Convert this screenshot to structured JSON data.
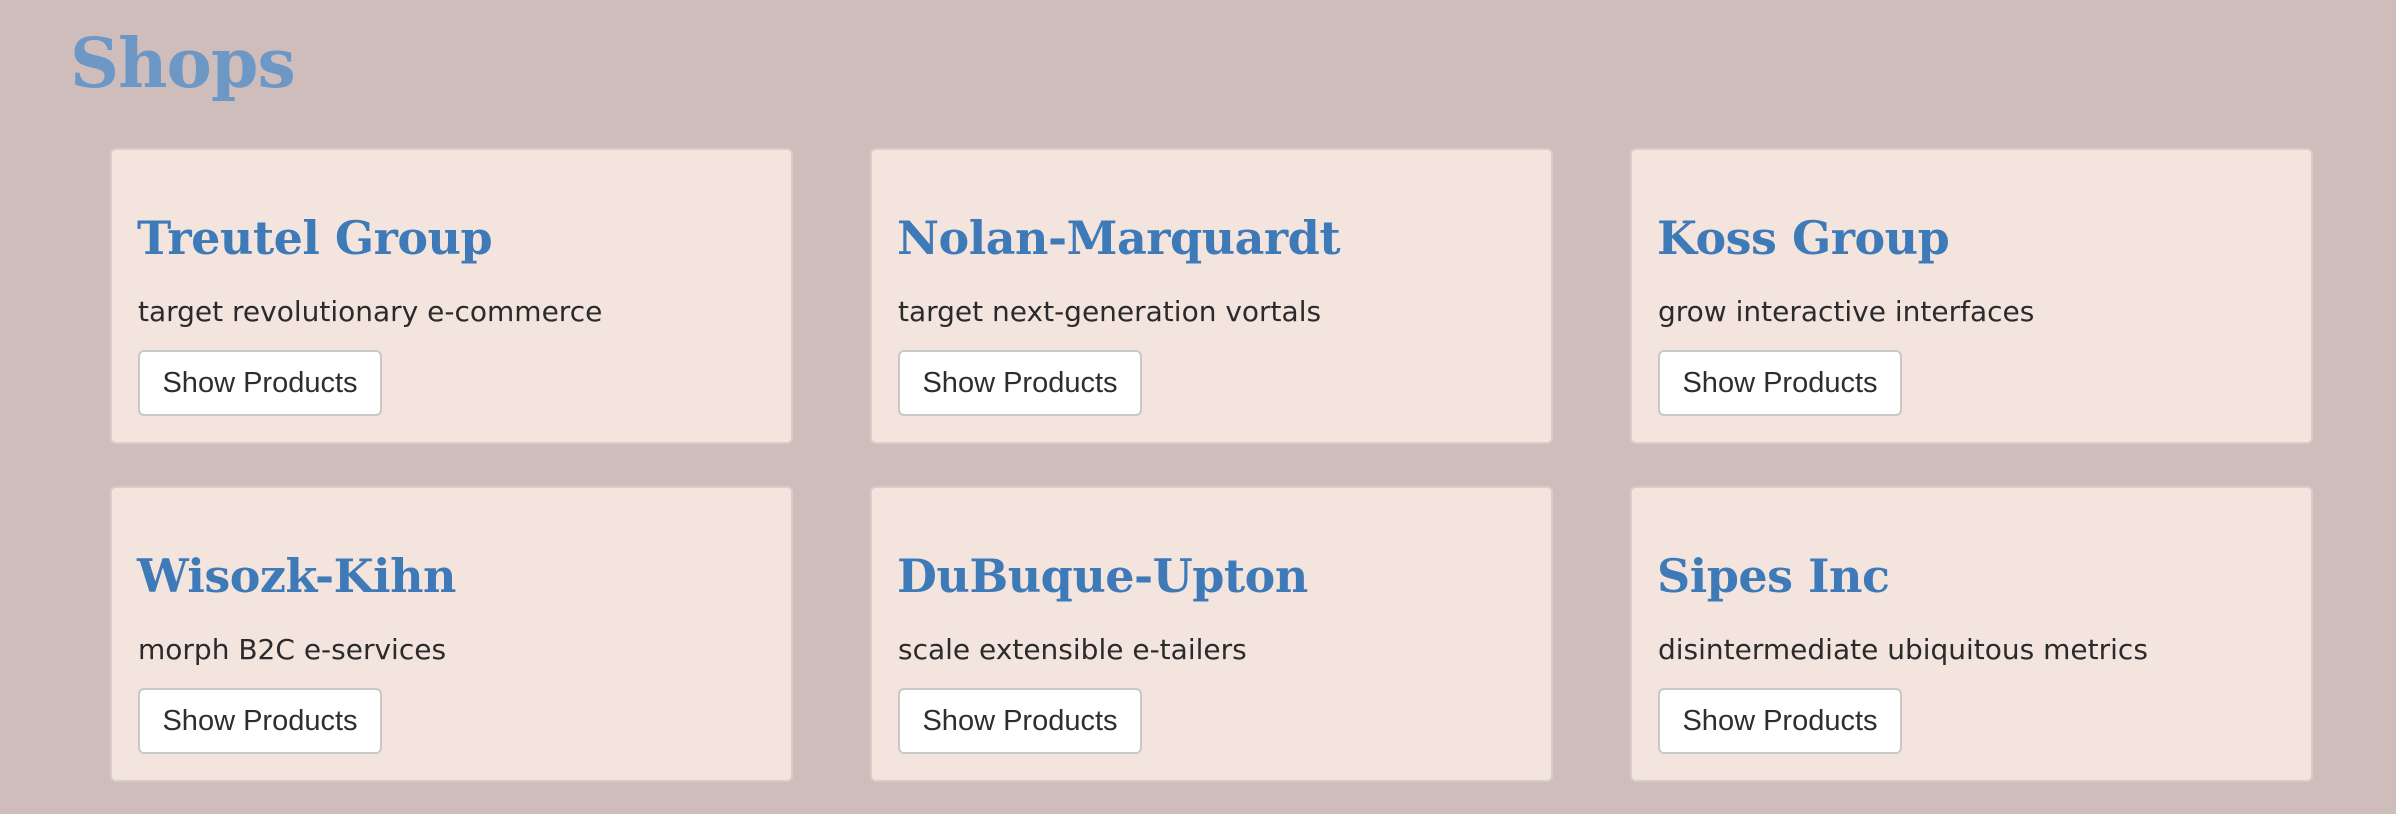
{
  "page": {
    "title": "Shops"
  },
  "shops": [
    {
      "name": "Treutel Group",
      "description": "target revolutionary e-commerce",
      "button_label": "Show Products"
    },
    {
      "name": "Nolan-Marquardt",
      "description": "target next-generation vortals",
      "button_label": "Show Products"
    },
    {
      "name": "Koss Group",
      "description": "grow interactive interfaces",
      "button_label": "Show Products"
    },
    {
      "name": "Wisozk-Kihn",
      "description": "morph B2C e-services",
      "button_label": "Show Products"
    },
    {
      "name": "DuBuque-Upton",
      "description": "scale extensible e-tailers",
      "button_label": "Show Products"
    },
    {
      "name": "Sipes Inc",
      "description": "disintermediate ubiquitous metrics",
      "button_label": "Show Products"
    }
  ],
  "colors": {
    "background": "#cfbdbc",
    "card_background": "#f3e4de",
    "title": "#6d98c6",
    "shop_name": "#3f7ab8"
  }
}
